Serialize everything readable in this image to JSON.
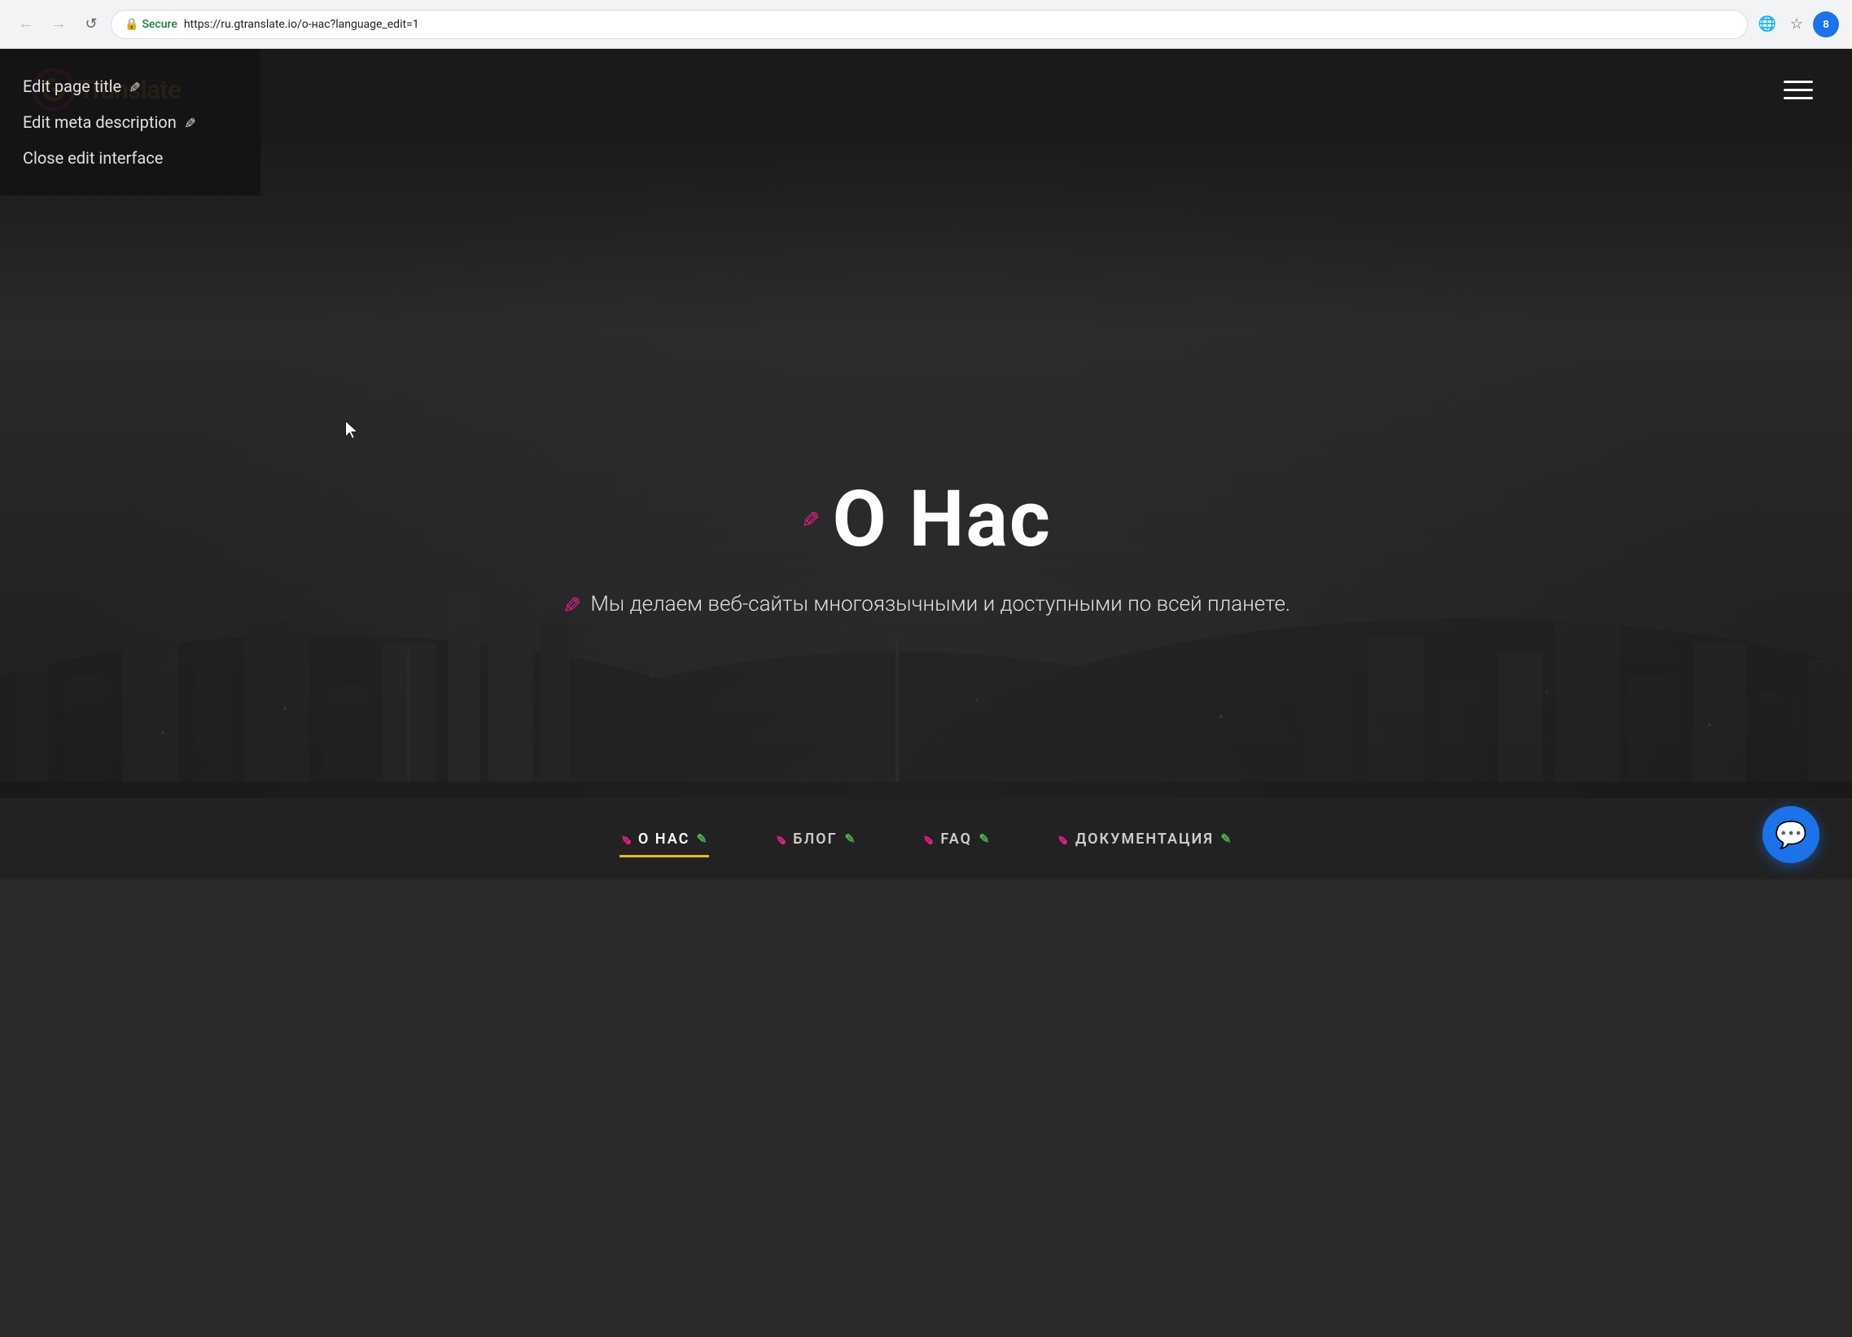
{
  "browser": {
    "url": "https://ru.gtranslate.io/о-нас?language_edit=1",
    "secure_label": "Secure",
    "secure_color": "#188038"
  },
  "header": {
    "logo_text": "Translate",
    "hamburger_label": "Menu"
  },
  "edit_panel": {
    "items": [
      {
        "id": "edit-title",
        "label": "Edit page title",
        "icon": "✏"
      },
      {
        "id": "edit-meta",
        "label": "Edit meta description",
        "icon": "✏"
      },
      {
        "id": "close-edit",
        "label": "Close edit interface",
        "icon": null
      }
    ]
  },
  "hero": {
    "title": "О Нас",
    "subtitle": "Мы делаем веб-сайты многоязычными и доступными по всей планете."
  },
  "nav": {
    "items": [
      {
        "id": "about",
        "label": "О НАС",
        "active": true
      },
      {
        "id": "blog",
        "label": "БЛОГ",
        "active": false
      },
      {
        "id": "faq",
        "label": "FAQ",
        "active": false
      },
      {
        "id": "docs",
        "label": "ДОКУМЕНТАЦИЯ",
        "active": false
      }
    ]
  },
  "colors": {
    "accent_orange": "#f5a623",
    "accent_pink": "#e91e8c",
    "accent_green": "#4caf50",
    "accent_blue": "#1a73e8",
    "accent_yellow": "#e8c200",
    "nav_bg": "#222222",
    "header_bg": "#1a1a1a"
  }
}
